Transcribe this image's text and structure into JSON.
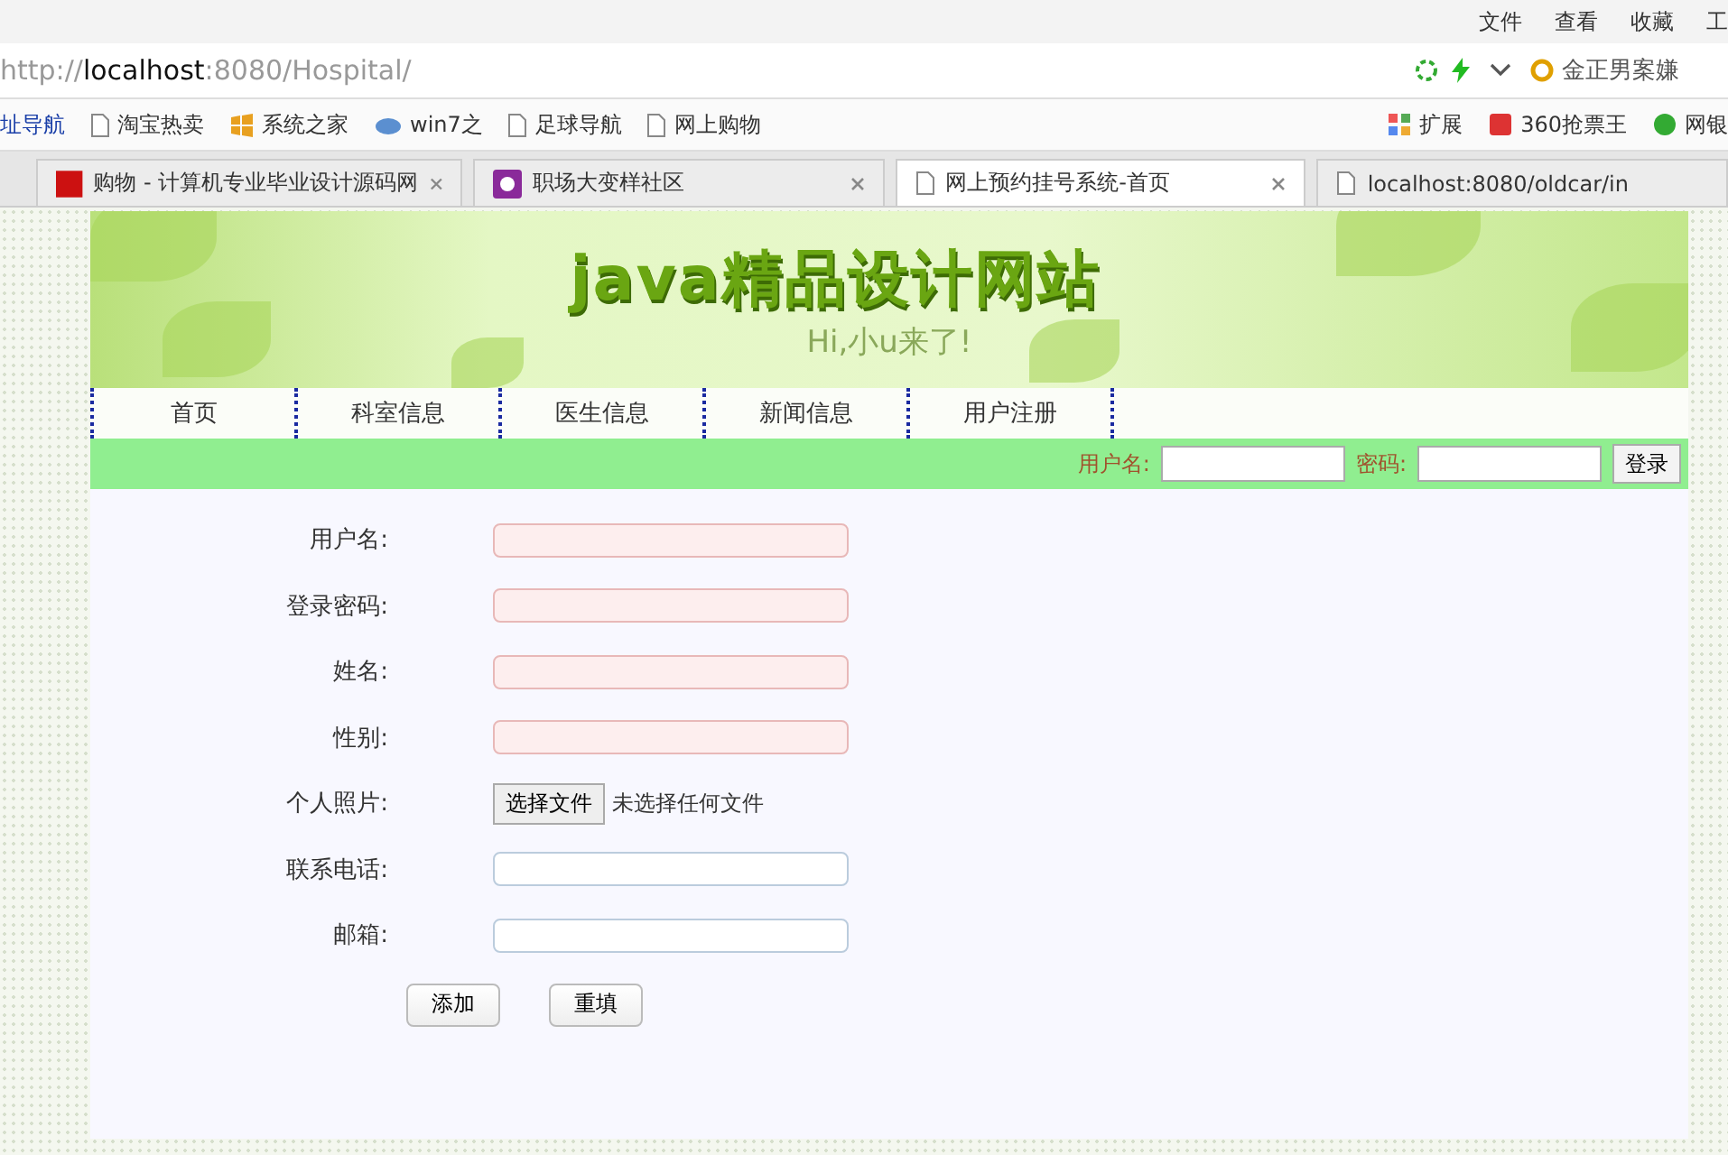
{
  "browser": {
    "menu": [
      "文件",
      "查看",
      "收藏",
      "工"
    ],
    "url_scheme": "http://",
    "url_host": "localhost",
    "url_rest": ":8080/Hospital/",
    "search": "金正男案嫌",
    "bookmarks": [
      {
        "label": "址导航",
        "kind": "link"
      },
      {
        "label": "淘宝热卖",
        "kind": "page"
      },
      {
        "label": "系统之家",
        "kind": "logo"
      },
      {
        "label": "win7之",
        "kind": "cloud"
      },
      {
        "label": "足球导航",
        "kind": "page"
      },
      {
        "label": "网上购物",
        "kind": "page"
      }
    ],
    "tools": [
      "扩展",
      "360抢票王",
      "网银"
    ],
    "tabs": [
      {
        "label": "购物 - 计算机专业毕业设计源码网",
        "selected": false
      },
      {
        "label": "职场大变样社区",
        "selected": false
      },
      {
        "label": "网上预约挂号系统-首页",
        "selected": true
      },
      {
        "label": "localhost:8080/oldcar/in",
        "selected": false
      }
    ]
  },
  "banner": {
    "title": "java精品设计网站",
    "subtitle": "Hi,小u来了!"
  },
  "nav": [
    "首页",
    "科室信息",
    "医生信息",
    "新闻信息",
    "用户注册"
  ],
  "login": {
    "user_label": "用户名:",
    "password_label": "密码:",
    "button": "登录"
  },
  "form": {
    "fields": [
      {
        "label": "用户名:",
        "kind": "text",
        "invalid": true
      },
      {
        "label": "登录密码:",
        "kind": "text",
        "invalid": true
      },
      {
        "label": "姓名:",
        "kind": "text",
        "invalid": true
      },
      {
        "label": "性别:",
        "kind": "text",
        "invalid": true
      },
      {
        "label": "个人照片:",
        "kind": "file",
        "button": "选择文件",
        "status": "未选择任何文件"
      },
      {
        "label": "联系电话:",
        "kind": "text",
        "invalid": false
      },
      {
        "label": "邮箱:",
        "kind": "text",
        "invalid": false
      }
    ],
    "buttons": [
      "添加",
      "重填"
    ]
  }
}
